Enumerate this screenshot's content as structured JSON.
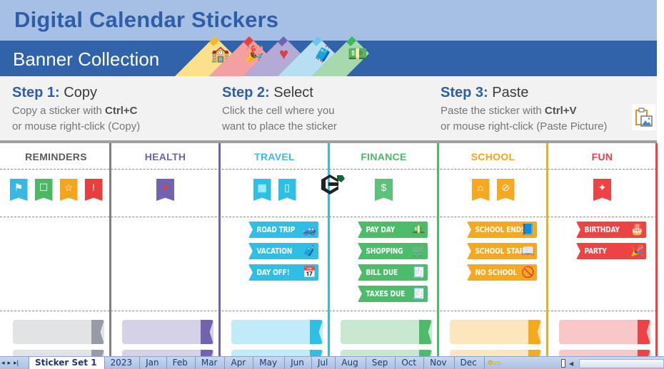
{
  "header": {
    "title": "Digital Calendar Stickers",
    "subtitle": "Banner Collection",
    "corner_flags": [
      {
        "icon": "school-building-icon",
        "color": "#fde08c",
        "accent": "#f6b922"
      },
      {
        "icon": "party-popper-icon",
        "color": "#f4a0a0",
        "accent": "#ea3d3d"
      },
      {
        "icon": "heart-icon",
        "color": "#b3abd6",
        "accent": "#7262b0"
      },
      {
        "icon": "suitcase-icon",
        "color": "#b7dff2",
        "accent": "#6cc6ea"
      },
      {
        "icon": "money-icon",
        "color": "#a6d9ae",
        "accent": "#3fb55f"
      }
    ]
  },
  "steps": [
    {
      "label": "Step 1:",
      "action": "Copy",
      "line1_prefix": "Copy a sticker with ",
      "line1_key": "Ctrl+C",
      "line2": "or mouse right-click (Copy)"
    },
    {
      "label": "Step 2:",
      "action": "Select",
      "line1_prefix": "Click the cell where you",
      "line1_key": "",
      "line2": "want to place the sticker"
    },
    {
      "label": "Step 3:",
      "action": "Paste",
      "line1_prefix": "Paste the sticker with ",
      "line1_key": "Ctrl+V",
      "line2": "or mouse right-click (Paste Picture)"
    }
  ],
  "paste_picture_icon": "paste-picture-icon",
  "categories": [
    {
      "name": "REMINDERS",
      "color": "#5a5a5a",
      "accent": "#969ca6",
      "light": "#e2e3e5",
      "minis": [
        {
          "icon": "flag-icon",
          "glyph": "⚑",
          "color": "#3ab6e3"
        },
        {
          "icon": "checkbox-icon",
          "glyph": "☐",
          "color": "#4cb863"
        },
        {
          "icon": "star-icon",
          "glyph": "☆",
          "color": "#f4a41d"
        },
        {
          "icon": "exclamation-icon",
          "glyph": "!",
          "color": "#ea3d3d"
        }
      ],
      "banners": []
    },
    {
      "name": "HEALTH",
      "color": "#6f62ad",
      "accent": "#7262b0",
      "light": "#d5d2e8",
      "minis": [
        {
          "icon": "heart-icon",
          "glyph": "♥",
          "color": "#7262b0"
        }
      ],
      "banners": []
    },
    {
      "name": "TRAVEL",
      "color": "#3fb8e2",
      "accent": "#2fbfe5",
      "light": "#c2ebf8",
      "minis": [
        {
          "icon": "calendar-icon",
          "glyph": "▦",
          "color": "#2fbfe5"
        },
        {
          "icon": "suitcase-icon",
          "glyph": "▯",
          "color": "#2fbfe5"
        }
      ],
      "banners": [
        {
          "label": "ROAD TRIP",
          "icon": "car-icon",
          "glyph": "🚙"
        },
        {
          "label": "VACATION",
          "icon": "suitcase-icon",
          "glyph": "🧳"
        },
        {
          "label": "DAY OFF!",
          "icon": "calendar-icon",
          "glyph": "📅"
        }
      ]
    },
    {
      "name": "FINANCE",
      "color": "#4cb863",
      "accent": "#4cbb6a",
      "light": "#c8e9d0",
      "minis": [
        {
          "icon": "money-icon",
          "glyph": "$",
          "color": "#5cc27a"
        }
      ],
      "banners": [
        {
          "label": "PAY DAY",
          "icon": "money-icon",
          "glyph": "💵"
        },
        {
          "label": "SHOPPING",
          "icon": "cart-icon",
          "glyph": "🛒"
        },
        {
          "label": "BILL DUE",
          "icon": "bill-icon",
          "glyph": "🧾"
        },
        {
          "label": "TAXES DUE",
          "icon": "bill-icon",
          "glyph": "🧾"
        }
      ]
    },
    {
      "name": "SCHOOL",
      "color": "#f4a41d",
      "accent": "#f6a81f",
      "light": "#fde5bd",
      "minis": [
        {
          "icon": "school-building-icon",
          "glyph": "⌂",
          "color": "#f6a81f"
        },
        {
          "icon": "no-school-icon",
          "glyph": "⊘",
          "color": "#f6a81f"
        }
      ],
      "banners": [
        {
          "label": "SCHOOL ENDS",
          "icon": "closed-book-icon",
          "glyph": "📘"
        },
        {
          "label": "SCHOOL STARTS",
          "icon": "open-book-icon",
          "glyph": "📖"
        },
        {
          "label": "NO SCHOOL",
          "icon": "no-school-icon",
          "glyph": "🚫"
        }
      ]
    },
    {
      "name": "FUN",
      "color": "#ea3d4a",
      "accent": "#ee4345",
      "light": "#f9c7c7",
      "minis": [
        {
          "icon": "party-popper-icon",
          "glyph": "✦",
          "color": "#ee4345"
        }
      ],
      "banners": [
        {
          "label": "BIRTHDAY",
          "icon": "cake-icon",
          "glyph": "🎂"
        },
        {
          "label": "PARTY",
          "icon": "party-popper-icon",
          "glyph": "🎉"
        }
      ]
    }
  ],
  "sheet_tabs": {
    "nav": [
      "◂",
      "▸",
      "▸|"
    ],
    "tabs": [
      "Sticker Set 1",
      "2023",
      "Jan",
      "Feb",
      "Mar",
      "Apr",
      "May",
      "Jun",
      "Jul",
      "Aug",
      "Sep",
      "Oct",
      "Nov",
      "Dec"
    ],
    "active": "Sticker Set 1",
    "new_sheet_icon": "insert-sheet-icon"
  }
}
